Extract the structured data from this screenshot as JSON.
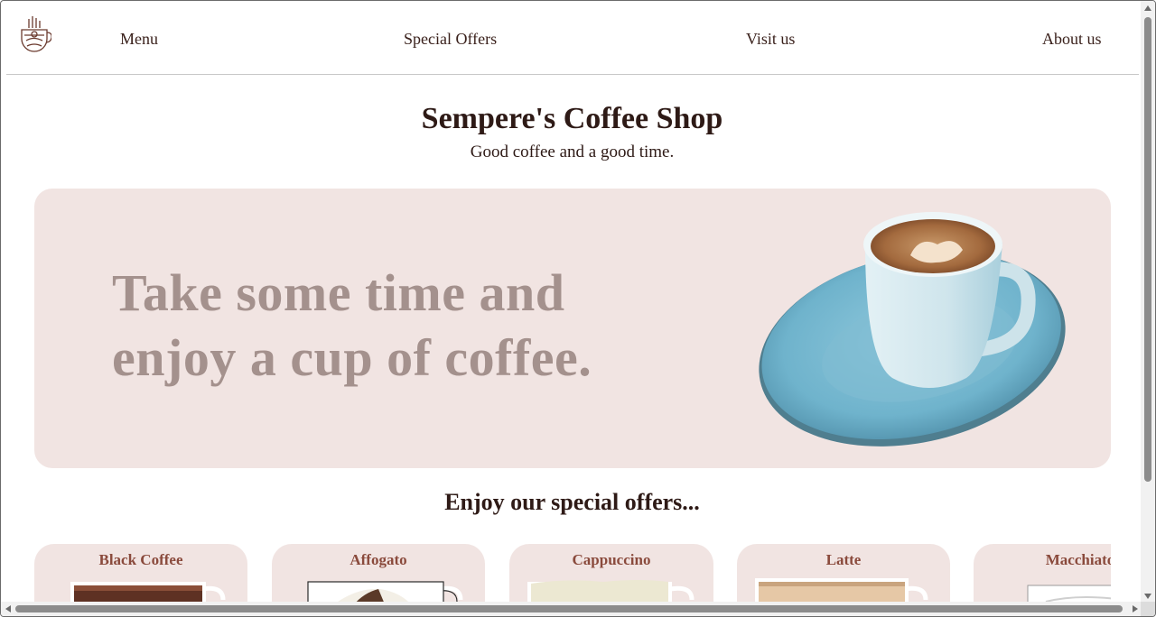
{
  "nav": {
    "items": [
      {
        "label": "Menu"
      },
      {
        "label": "Special Offers"
      },
      {
        "label": "Visit us"
      },
      {
        "label": "About us"
      }
    ],
    "logo_icon": "coffee-cup-logo-icon"
  },
  "header": {
    "title": "Sempere's Coffee Shop",
    "tagline": "Good coffee and a good time."
  },
  "hero": {
    "line1": "Take some time and",
    "line2": "enjoy a cup of coffee.",
    "image_icon": "coffee-cup-saucer-icon"
  },
  "offers": {
    "title": "Enjoy our special offers...",
    "cards": [
      {
        "name": "Black Coffee",
        "liquid": "#5e3123"
      },
      {
        "name": "Affogato",
        "liquid": "#f3efe6"
      },
      {
        "name": "Cappuccino",
        "liquid": "#ece8d2"
      },
      {
        "name": "Latte",
        "liquid": "#e6c8a6"
      },
      {
        "name": "Macchiato",
        "liquid": "#f4f0ea"
      }
    ]
  },
  "colors": {
    "accent_bg": "#f1e4e2",
    "text_dark": "#2e1a16",
    "hero_text": "#a4918d",
    "card_title": "#8a4a3c"
  }
}
